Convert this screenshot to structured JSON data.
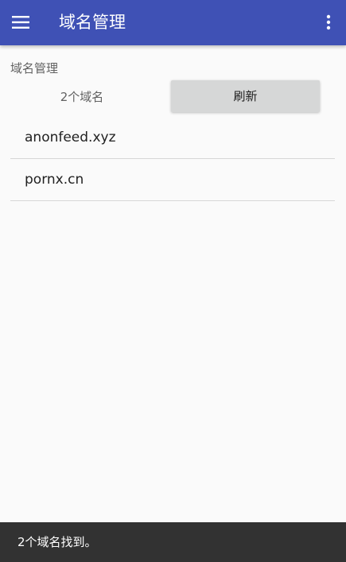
{
  "appbar": {
    "title": "域名管理",
    "menu_icon": "hamburger-menu-icon",
    "overflow_icon": "more-vertical-icon",
    "color": "#3f51b5"
  },
  "section": {
    "label": "域名管理",
    "count_label": "2个域名",
    "refresh_label": "刷新"
  },
  "domains": [
    {
      "name": "anonfeed.xyz"
    },
    {
      "name": "pornx.cn"
    }
  ],
  "snackbar": {
    "message": "2个域名找到。"
  }
}
